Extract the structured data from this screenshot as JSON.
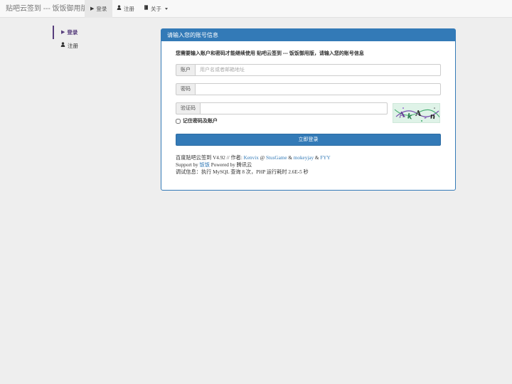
{
  "navbar": {
    "brand": "贴吧云签到 --- 饭饭御用版",
    "items": [
      {
        "label": "登录",
        "icon": "play-icon"
      },
      {
        "label": "注册",
        "icon": "user-icon"
      },
      {
        "label": "关于",
        "icon": "book-icon"
      }
    ]
  },
  "sidebar": {
    "items": [
      {
        "label": "登录",
        "icon": "play-icon"
      },
      {
        "label": "注册",
        "icon": "user-icon"
      }
    ]
  },
  "panel": {
    "title": "请输入您的账号信息",
    "intro": "您需要输入账户和密码才能继续使用 贴吧云签到 --- 饭饭御用版，请输入您的账号信息",
    "account_label": "账户",
    "account_placeholder": "用户名或者邮箱地址",
    "account_value": "",
    "password_label": "密码",
    "password_value": "",
    "captcha_label": "验证码",
    "captcha_value": "",
    "remember_label": "记住密码及账户",
    "login_button": "立即登录"
  },
  "footer": {
    "line1_prefix": "百度贴吧云签到 V4.92 // 作者: ",
    "author1": "Kenvix",
    "at": " @ ",
    "author2": "StusGame",
    "amp1": " & ",
    "author3": "mokeyjay",
    "amp2": " & ",
    "author4": "FYY",
    "line2_prefix": "Support by ",
    "support": "饭饭",
    "line2_suffix": " Powered by 腾讯云",
    "line3": "调试信息：执行 MySQL 查询 8 次，PHP 运行耗时 2.6E-5 秒"
  },
  "colors": {
    "primary": "#337ab7",
    "sidebar_active": "#563d7c",
    "background": "#eeeeee"
  }
}
